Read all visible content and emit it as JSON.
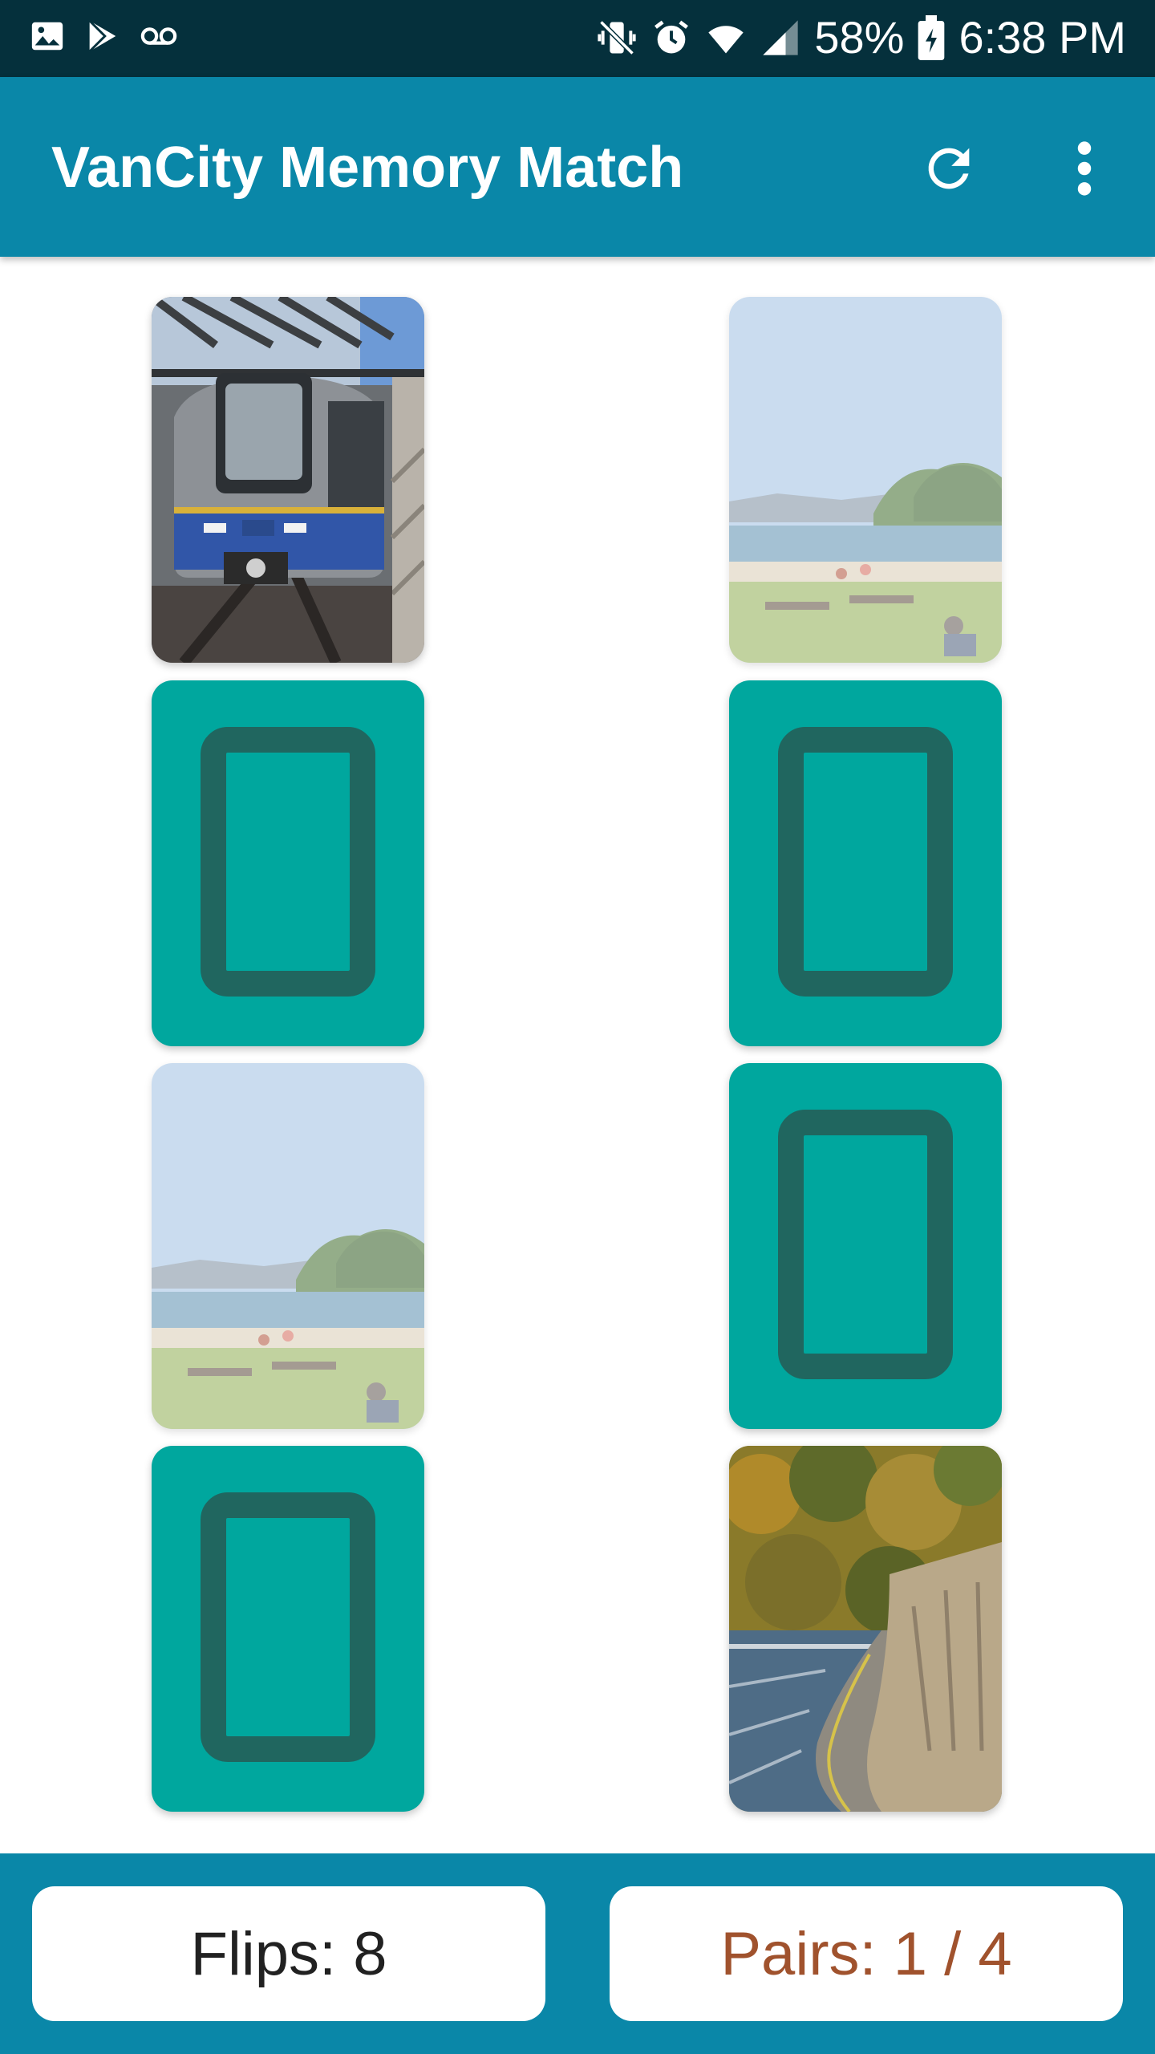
{
  "status_bar": {
    "notification_icons": [
      "image-icon",
      "play-store-icon",
      "voicemail-icon"
    ],
    "system_icons": [
      "vibrate-mute-icon",
      "alarm-icon",
      "wifi-icon",
      "signal-icon"
    ],
    "battery": "58%",
    "time": "6:38 PM"
  },
  "app_bar": {
    "title": "VanCity Memory Match",
    "actions": [
      "refresh-icon",
      "more-vert-icon"
    ],
    "color": "#0a87a8"
  },
  "board": {
    "columns": 2,
    "rows": 4,
    "cards": [
      {
        "position": 1,
        "state": "face-up",
        "image": "skytrain"
      },
      {
        "position": 2,
        "state": "matched",
        "image": "beach"
      },
      {
        "position": 3,
        "state": "face-down"
      },
      {
        "position": 4,
        "state": "face-down"
      },
      {
        "position": 5,
        "state": "matched",
        "image": "beach"
      },
      {
        "position": 6,
        "state": "face-down"
      },
      {
        "position": 7,
        "state": "face-down"
      },
      {
        "position": 8,
        "state": "face-up",
        "image": "seawall"
      }
    ],
    "card_back_color": "#00a79e",
    "card_back_inner_color": "#20665f"
  },
  "footer": {
    "flips": "Flips: 8",
    "pairs": "Pairs: 1 / 4",
    "pairs_color": "#a0522d"
  }
}
